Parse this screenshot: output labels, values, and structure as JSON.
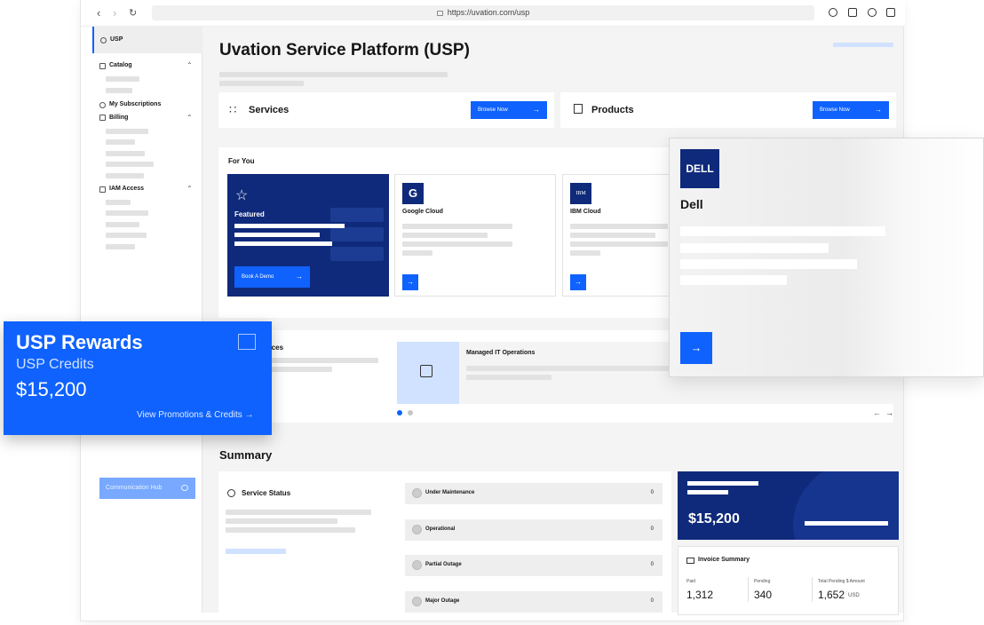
{
  "browser": {
    "url": "https://uvation.com/usp"
  },
  "sidebar": {
    "top_label": "USP",
    "catalog_label": "Catalog",
    "subscriptions_label": "My Subscriptions",
    "billing_label": "Billing",
    "iam_label": "IAM Access",
    "comm_hub_label": "Communication Hub"
  },
  "page": {
    "title": "Uvation Service Platform (USP)"
  },
  "services_card": {
    "title": "Services",
    "button": "Browse Now"
  },
  "products_card": {
    "title": "Products",
    "button": "Browse Now"
  },
  "for_you": {
    "title": "For You",
    "featured_label": "Featured",
    "demo_button": "Book A Demo",
    "cards": [
      {
        "name": "Google Cloud",
        "logo": "G"
      },
      {
        "name": "IBM Cloud",
        "logo": "IBM"
      }
    ]
  },
  "services_section": {
    "title_partial": "vices",
    "item_title": "Managed IT Operations"
  },
  "rewards": {
    "title": "USP Rewards",
    "subtitle": "USP Credits",
    "amount": "$15,200",
    "link": "View Promotions & Credits"
  },
  "dell": {
    "logo": "DELL",
    "name": "Dell"
  },
  "summary": {
    "title": "Summary",
    "service_status_title": "Service Status",
    "statuses": [
      {
        "label": "Under Maintenance",
        "value": "0"
      },
      {
        "label": "Operational",
        "value": "0"
      },
      {
        "label": "Partial Outage",
        "value": "0"
      },
      {
        "label": "Major Outage",
        "value": "0"
      }
    ],
    "balance": "$15,200",
    "invoice_title": "Invoice Summary",
    "invoice": [
      {
        "label": "Paid",
        "value": "1,312",
        "unit": ""
      },
      {
        "label": "Pending",
        "value": "340",
        "unit": ""
      },
      {
        "label": "Total Pending $ Amount",
        "value": "1,652",
        "unit": "USD"
      }
    ]
  },
  "colors": {
    "accent": "#0f62fe",
    "navy": "#0f2a7a",
    "light_accent": "#78a9ff"
  }
}
